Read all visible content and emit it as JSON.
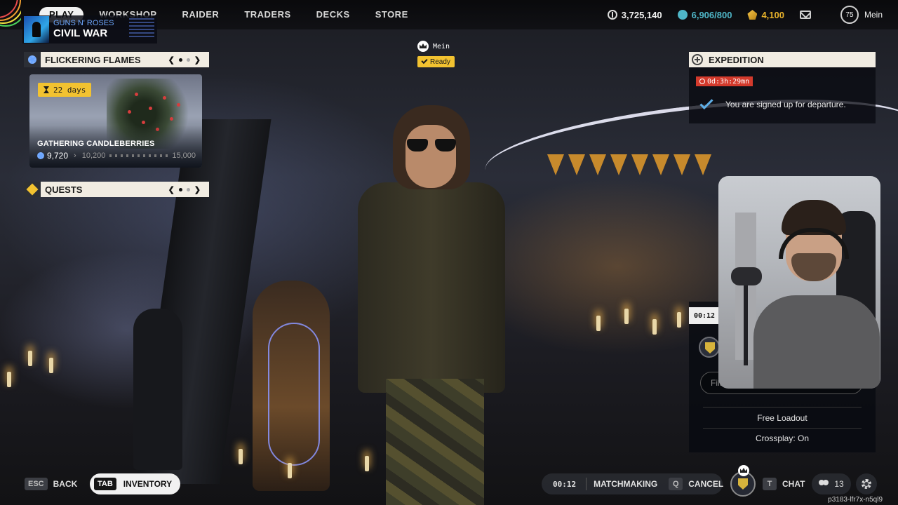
{
  "music": {
    "artist": "GUNS N' ROSES",
    "track": "CIVIL WAR"
  },
  "nav": {
    "play": "PLAY",
    "workshop": "WORKSHOP",
    "raider": "RAIDER",
    "traders": "TRADERS",
    "decks": "DECKS",
    "store": "STORE"
  },
  "currencies": {
    "coins": "3,725,140",
    "creds": "6,906/800",
    "raider_tokens": "4,100"
  },
  "profile": {
    "level": "75",
    "name": "Mein"
  },
  "event": {
    "title": "FLICKERING FLAMES",
    "days": "22 days",
    "card_title": "GATHERING CANDLEBERRIES",
    "progress_current": "9,720",
    "progress_next": "10,200",
    "progress_max": "15,000"
  },
  "quests": {
    "title": "QUESTS"
  },
  "lobby": {
    "player_name": "Mein",
    "status": "Ready"
  },
  "expedition": {
    "title": "EXPEDITION",
    "timer": "0d:3h:29mn",
    "status": "You are signed up for departure."
  },
  "squad": {
    "timer": "00:12",
    "filter_placeholder": "Filter",
    "option1": "Free Loadout",
    "option2": "Crossplay: On"
  },
  "bottom": {
    "back_key": "ESC",
    "back_label": "BACK",
    "inv_key": "TAB",
    "inv_label": "INVENTORY",
    "mm_time": "00:12",
    "mm_label": "MATCHMAKING",
    "cancel_key": "Q",
    "cancel_label": "CANCEL",
    "chat_key": "T",
    "chat_label": "CHAT",
    "friends_count": "13",
    "session_id": "p3183-lfr7x-n5ql9"
  },
  "colors": {
    "accent_yellow": "#f2c230",
    "timer_red": "#d33a2c",
    "creds_teal": "#4fb6c8",
    "check_blue": "#5fb0e8"
  }
}
